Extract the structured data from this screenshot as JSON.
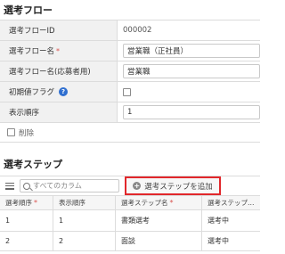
{
  "section1": {
    "title": "選考フロー",
    "rows": [
      {
        "label": "選考フローID",
        "value": "000002"
      },
      {
        "label": "選考フロー名",
        "required": "*",
        "value": "営業職（正社員）"
      },
      {
        "label": "選考フロー名(応募者用)",
        "value": "営業職"
      },
      {
        "label": "初期値フラグ",
        "help_icon": "?"
      },
      {
        "label": "表示順序",
        "value": "1"
      }
    ],
    "delete_label": "削除"
  },
  "section2": {
    "title": "選考ステップ",
    "search_placeholder": "すべてのカラム",
    "add_button_label": "選考ステップを追加",
    "add_button_icon": "+",
    "columns": [
      "選考順序",
      "表示順序",
      "選考ステップ名",
      "選考ステップ…"
    ],
    "column_required": "*",
    "rows": [
      [
        "1",
        "1",
        "書類選考",
        "選考中"
      ],
      [
        "2",
        "2",
        "面談",
        "選考中"
      ]
    ]
  },
  "colors": {
    "highlight_border": "#e1272b",
    "help_icon": "#2f6fd0",
    "required": "#d9534f"
  }
}
